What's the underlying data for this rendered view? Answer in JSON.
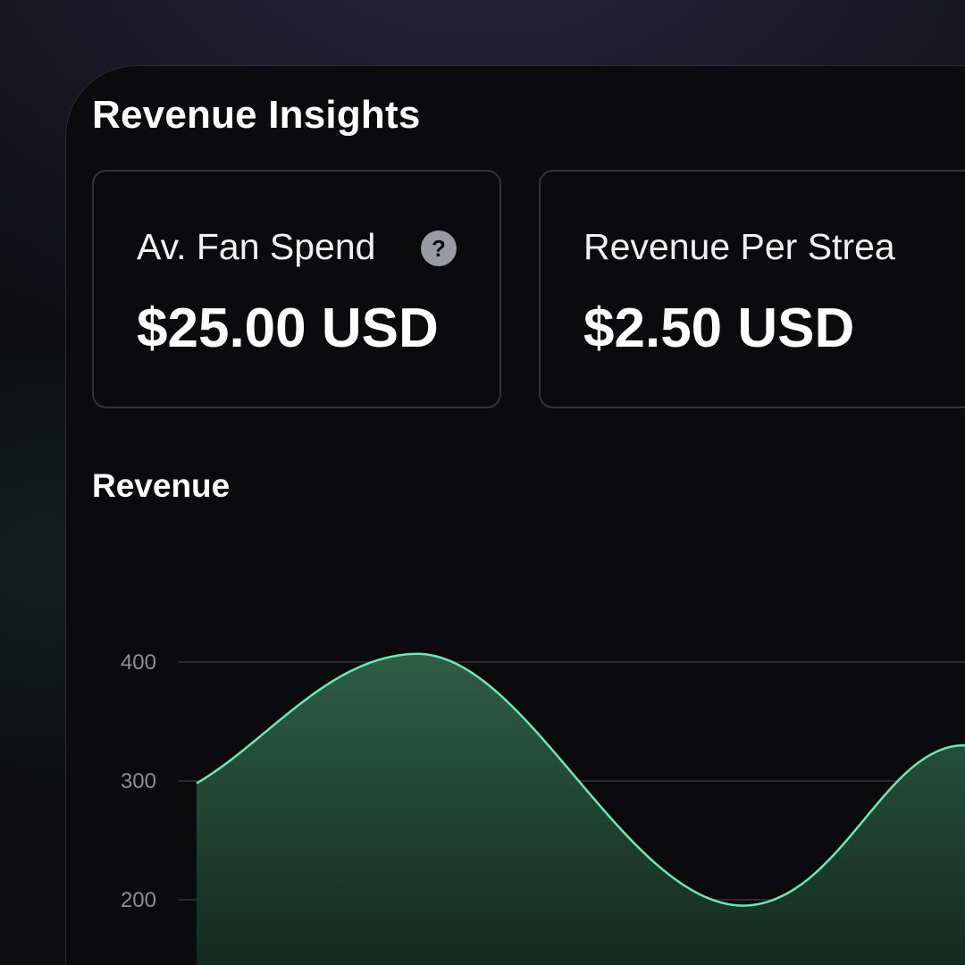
{
  "header": {
    "title": "Revenue Insights"
  },
  "cards": [
    {
      "label": "Av. Fan Spend",
      "value": "$25.00 USD",
      "icon": "help-icon"
    },
    {
      "label": "Revenue Per Strea",
      "value": "$2.50 USD"
    }
  ],
  "section": {
    "title": "Revenue"
  },
  "colors": {
    "accent": "#6ee7b7",
    "fill_top": "#2f5d48",
    "fill_bottom": "#132a20",
    "grid": "#34343c"
  },
  "chart_data": {
    "type": "area",
    "x": [
      0,
      1,
      2,
      3,
      4
    ],
    "values": [
      298,
      407,
      195,
      330,
      330
    ],
    "yticks": [
      400,
      300,
      200
    ],
    "ylim": [
      150,
      450
    ],
    "grid": true
  }
}
